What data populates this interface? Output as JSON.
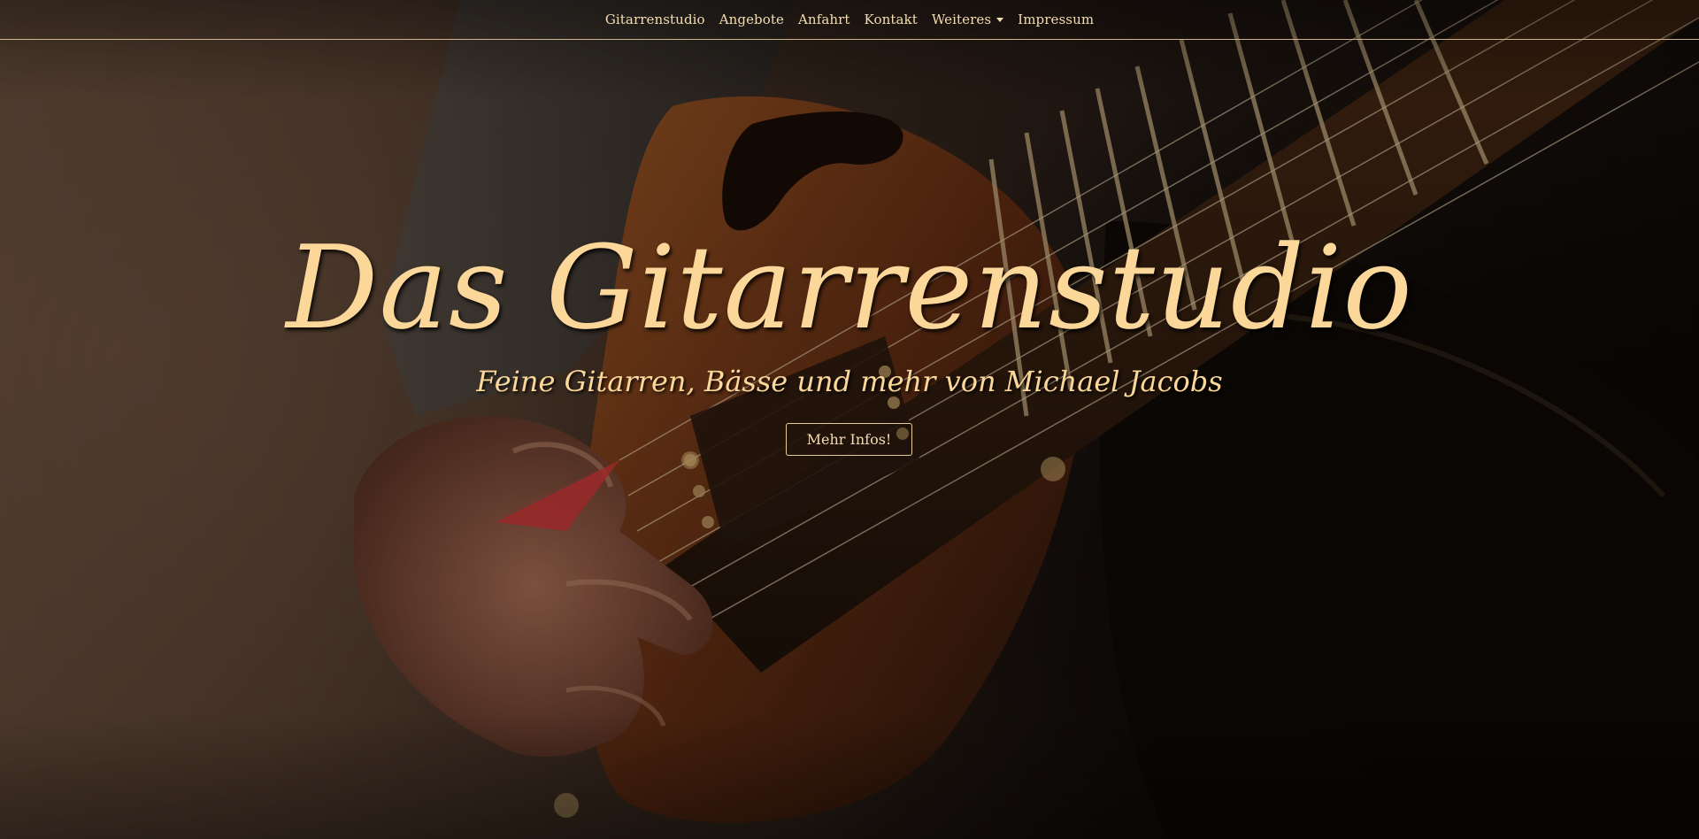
{
  "nav": {
    "items": [
      {
        "label": "Gitarrenstudio",
        "has_dropdown": false
      },
      {
        "label": "Angebote",
        "has_dropdown": false
      },
      {
        "label": "Anfahrt",
        "has_dropdown": false
      },
      {
        "label": "Kontakt",
        "has_dropdown": false
      },
      {
        "label": "Weiteres",
        "has_dropdown": true
      },
      {
        "label": "Impressum",
        "has_dropdown": false
      }
    ]
  },
  "hero": {
    "title": "Das Gitarrenstudio",
    "subtitle": "Feine Gitarren, Bässe und mehr von Michael Jacobs",
    "cta_label": "Mehr Infos!"
  },
  "colors": {
    "accent": "#fbd79a",
    "nav_text": "#f4dcb0",
    "nav_border": "#cdb48a"
  }
}
